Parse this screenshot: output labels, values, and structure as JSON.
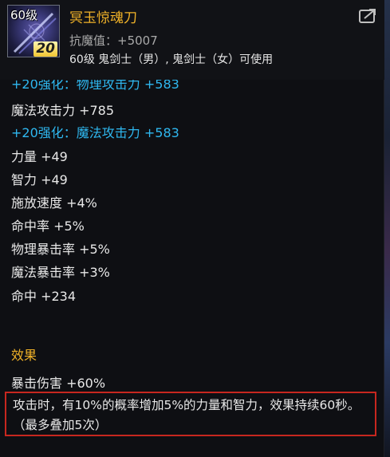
{
  "item": {
    "icon_level": "60级",
    "icon_enhance": "20",
    "name": "冥玉惊魂刀",
    "anti_magic": "抗魔值：+5007",
    "usable_by": "60级 鬼剑士（男）, 鬼剑士（女）可使用"
  },
  "icons": {
    "item_icon": "weapon-icon",
    "share_icon": "share-icon"
  },
  "stats": [
    {
      "text": "+20强化：物理攻击力 +583",
      "enhance": true,
      "partial": true
    },
    {
      "text": "魔法攻击力 +785",
      "enhance": false
    },
    {
      "text": "+20强化：魔法攻击力 +583",
      "enhance": true
    },
    {
      "text": "力量 +49",
      "enhance": false
    },
    {
      "text": "智力 +49",
      "enhance": false
    },
    {
      "text": "施放速度 +4%",
      "enhance": false
    },
    {
      "text": "命中率 +5%",
      "enhance": false
    },
    {
      "text": "物理暴击率 +5%",
      "enhance": false
    },
    {
      "text": "魔法暴击率 +3%",
      "enhance": false
    },
    {
      "text": "命中 +234",
      "enhance": false
    }
  ],
  "effect": {
    "title": "效果",
    "line": "暴击伤害 +60%",
    "description": "攻击时，有10%的概率增加5%的力量和智力，效果持续60秒。（最多叠加5次）"
  },
  "colors": {
    "item_name": "#f0b228",
    "enhance_text": "#2fb8f0",
    "normal_text": "#e8e8e8",
    "highlight_border": "#c7271f"
  }
}
